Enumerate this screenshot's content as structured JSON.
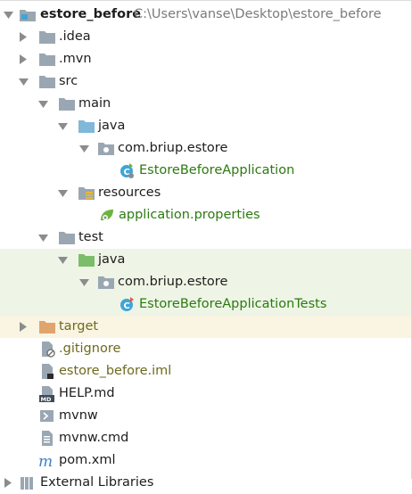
{
  "colors": {
    "folder": "#9aa7b2",
    "folder_source": "#7fb8d8",
    "folder_test": "#7cbd6a",
    "folder_excluded": "#e0a46c",
    "class_icon": "#3fa5d8",
    "text_green": "#2c7a10",
    "text_olive": "#6e6a1e",
    "highlight_test": "#eef5e6",
    "highlight_excluded": "#f9f5e2"
  },
  "project": {
    "name": "estore_before",
    "path": "C:\\Users\\vanse\\Desktop\\estore_before",
    "icon": "project-folder-icon"
  },
  "tree": [
    {
      "label": ".idea",
      "icon": "folder-icon",
      "expanded": false
    },
    {
      "label": ".mvn",
      "icon": "folder-icon",
      "expanded": false
    },
    {
      "label": "src",
      "icon": "folder-icon",
      "expanded": true
    },
    {
      "label": "main",
      "icon": "folder-icon",
      "expanded": true
    },
    {
      "label": "java",
      "icon": "source-root-folder-icon",
      "expanded": true
    },
    {
      "label": "com.briup.estore",
      "icon": "package-icon",
      "expanded": true
    },
    {
      "label": "EstoreBeforeApplication",
      "icon": "spring-boot-class-icon"
    },
    {
      "label": "resources",
      "icon": "resources-folder-icon",
      "expanded": true
    },
    {
      "label": "application.properties",
      "icon": "spring-properties-icon"
    },
    {
      "label": "test",
      "icon": "folder-icon",
      "expanded": true
    },
    {
      "label": "java",
      "icon": "test-source-folder-icon",
      "expanded": true
    },
    {
      "label": "com.briup.estore",
      "icon": "package-icon",
      "expanded": true
    },
    {
      "label": "EstoreBeforeApplicationTests",
      "icon": "test-class-icon"
    },
    {
      "label": "target",
      "icon": "excluded-folder-icon",
      "expanded": false
    },
    {
      "label": ".gitignore",
      "icon": "ignored-file-icon"
    },
    {
      "label": "estore_before.iml",
      "icon": "iml-file-icon"
    },
    {
      "label": "HELP.md",
      "icon": "markdown-file-icon"
    },
    {
      "label": "mvnw",
      "icon": "shell-script-icon"
    },
    {
      "label": "mvnw.cmd",
      "icon": "text-file-icon"
    },
    {
      "label": "pom.xml",
      "icon": "maven-icon"
    },
    {
      "label": "External Libraries",
      "icon": "libraries-icon",
      "expanded": false
    }
  ]
}
